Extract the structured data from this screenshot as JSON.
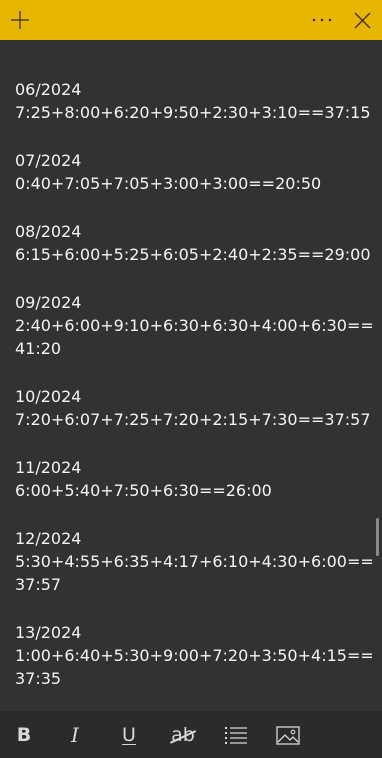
{
  "colors": {
    "title_bar": "#e8b500",
    "background": "#323232",
    "text": "#f4f4f4",
    "toolbar_icons": "#d8d8d8"
  },
  "title_bar": {
    "add_icon": "plus-icon",
    "more_icon": "ellipsis-icon",
    "close_icon": "close-icon"
  },
  "note": {
    "entries": [
      {
        "title": "06/2024",
        "lines": [
          "7:25+8:00+6:20+9:50+2:30+3:10==37:15"
        ]
      },
      {
        "title": "07/2024",
        "lines": [
          "0:40+7:05+7:05+3:00+3:00==20:50"
        ]
      },
      {
        "title": "08/2024",
        "lines": [
          "6:15+6:00+5:25+6:05+2:40+2:35==29:00"
        ]
      },
      {
        "title": "09/2024",
        "lines": [
          "2:40+6:00+9:10+6:30+6:30+4:00+6:30==",
          "41:20"
        ]
      },
      {
        "title": "10/2024",
        "lines": [
          "7:20+6:07+7:25+7:20+2:15+7:30==37:57"
        ]
      },
      {
        "title": "11/2024",
        "lines": [
          "6:00+5:40+7:50+6:30==26:00"
        ]
      },
      {
        "title": "12/2024",
        "lines": [
          "5:30+4:55+6:35+4:17+6:10+4:30+6:00==",
          "37:57"
        ]
      },
      {
        "title": "13/2024",
        "lines": [
          "1:00+6:40+5:30+9:00+7:20+3:50+4:15==",
          "37:35"
        ]
      }
    ]
  },
  "toolbar": {
    "bold_label": "B",
    "italic_label": "I",
    "underline_label": "U",
    "strikethrough_label": "ab",
    "list_icon": "bullet-list-icon",
    "image_icon": "image-icon"
  }
}
